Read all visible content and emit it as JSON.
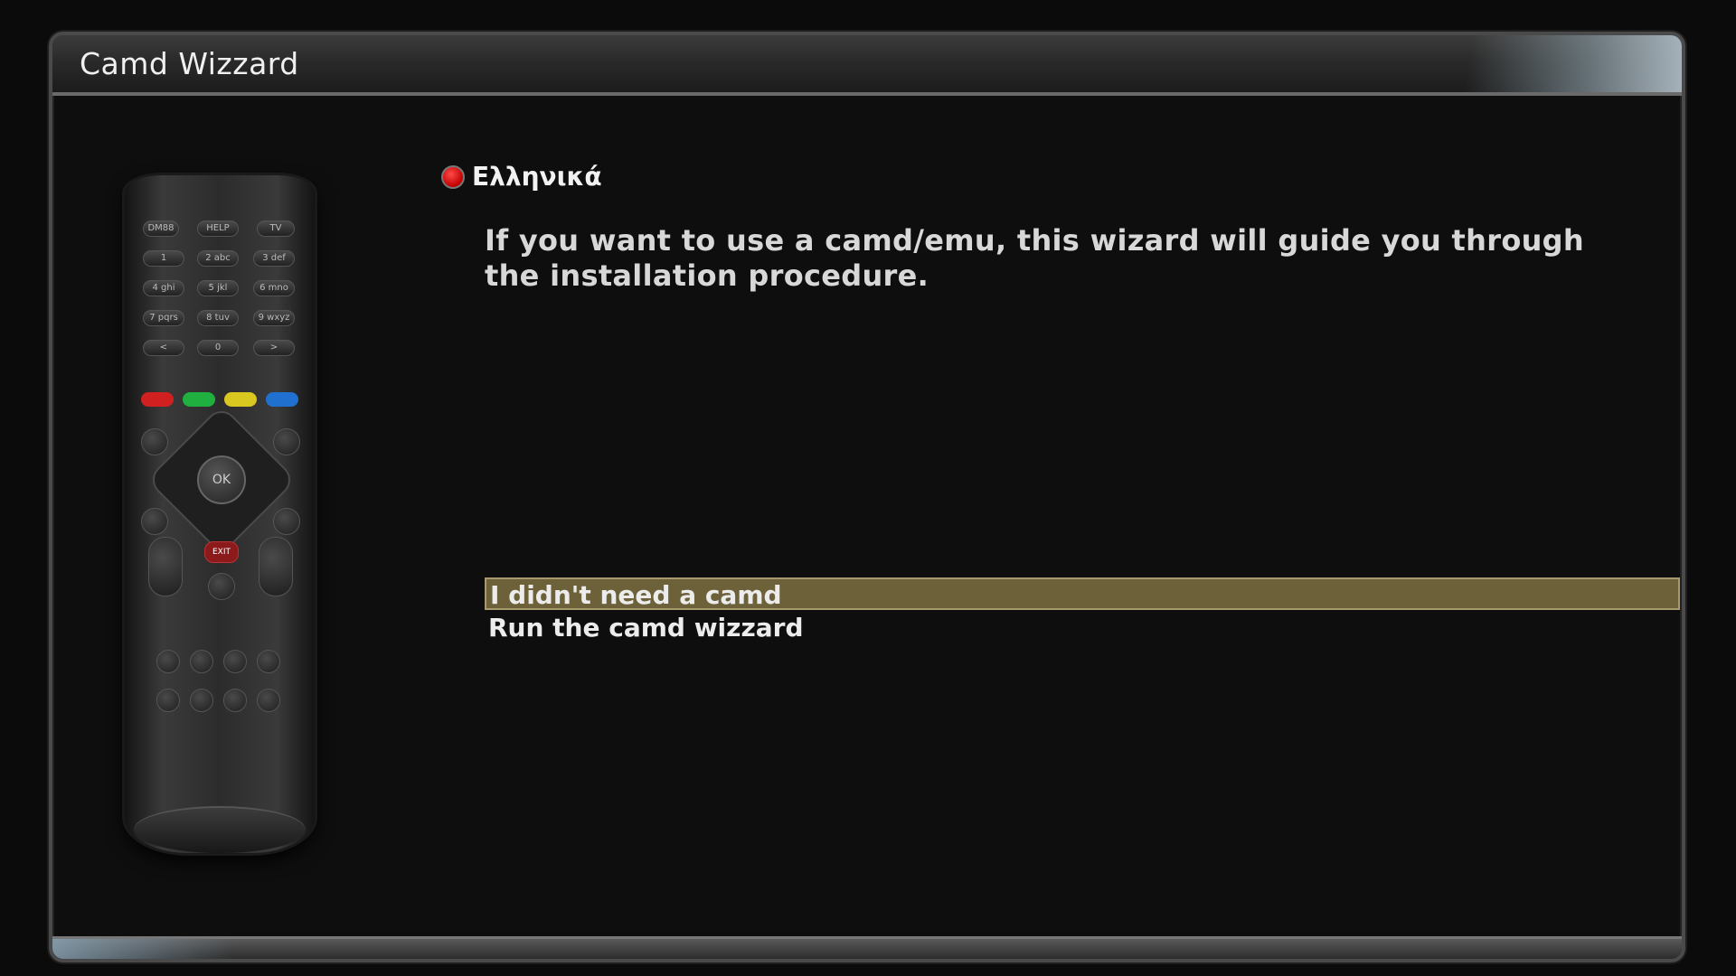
{
  "window": {
    "title": "Camd Wizzard"
  },
  "language": {
    "label": "Ελληνικά",
    "indicator_color": "#d00000"
  },
  "description": "If you want to use a camd/emu, this wizard will guide you through the installation procedure.",
  "menu": {
    "items": [
      {
        "label": "I didn't need a camd",
        "selected": true
      },
      {
        "label": "Run the camd wizzard",
        "selected": false
      }
    ],
    "selection_color": "#6d613a"
  },
  "remote": {
    "buttons": [
      "DM88",
      "HELP",
      "TV",
      "1",
      "2 abc",
      "3 def",
      "4 ghi",
      "5 jkl",
      "6 mno",
      "7 pqrs",
      "8 tuv",
      "9 wxyz",
      "<",
      "0",
      ">"
    ],
    "ok_label": "OK",
    "exit_label": "EXIT",
    "colors": [
      "#d02020",
      "#20b040",
      "#d8c820",
      "#2070d0"
    ]
  }
}
